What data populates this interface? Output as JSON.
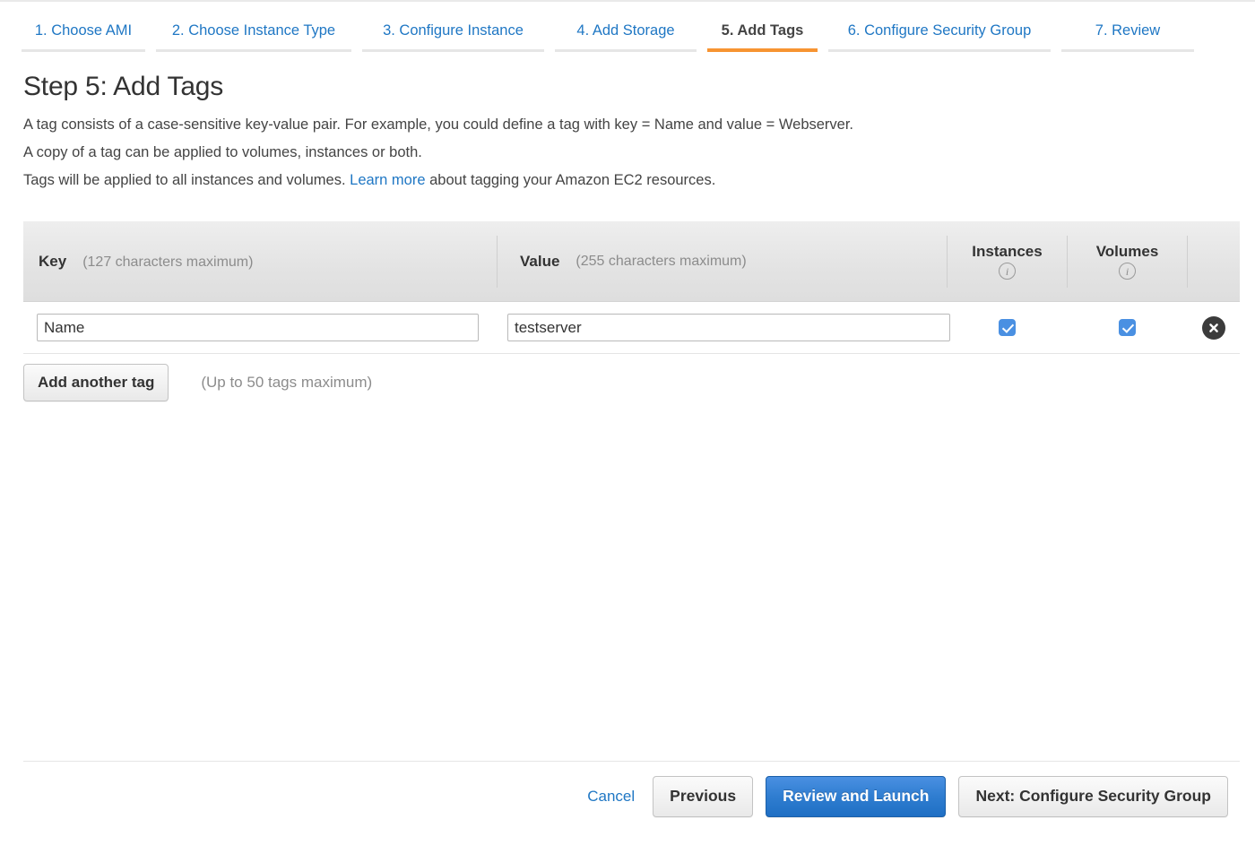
{
  "wizard": {
    "tabs": [
      {
        "label": "1. Choose AMI",
        "active": false
      },
      {
        "label": "2. Choose Instance Type",
        "active": false
      },
      {
        "label": "3. Configure Instance",
        "active": false
      },
      {
        "label": "4. Add Storage",
        "active": false
      },
      {
        "label": "5. Add Tags",
        "active": true
      },
      {
        "label": "6. Configure Security Group",
        "active": false
      },
      {
        "label": "7. Review",
        "active": false
      }
    ],
    "accent_active_color": "#f79432",
    "link_color": "#1f77c4"
  },
  "page": {
    "title": "Step 5: Add Tags",
    "description_line_1": "A tag consists of a case-sensitive key-value pair. For example, you could define a tag with key = Name and value = Webserver.",
    "description_line_2": "A copy of a tag can be applied to volumes, instances or both.",
    "description_line_3_before": "Tags will be applied to all instances and volumes.",
    "description_link": "Learn more",
    "description_line_3_after": "about tagging your Amazon EC2 resources."
  },
  "tag_table": {
    "headers": {
      "key_label": "Key",
      "key_hint": "(127 characters maximum)",
      "value_label": "Value",
      "value_hint": "(255 characters maximum)",
      "instances_label": "Instances",
      "volumes_label": "Volumes",
      "info_glyph": "i"
    },
    "rows": [
      {
        "key": "Name",
        "value": "testserver",
        "instances_checked": true,
        "volumes_checked": true,
        "delete_glyph": "✕"
      }
    ]
  },
  "add_tag": {
    "button_label": "Add another tag",
    "hint": "(Up to 50 tags maximum)"
  },
  "footer": {
    "cancel_label": "Cancel",
    "previous_label": "Previous",
    "review_label": "Review and Launch",
    "next_label": "Next: Configure Security Group",
    "primary_color": "#2f7dd0"
  }
}
